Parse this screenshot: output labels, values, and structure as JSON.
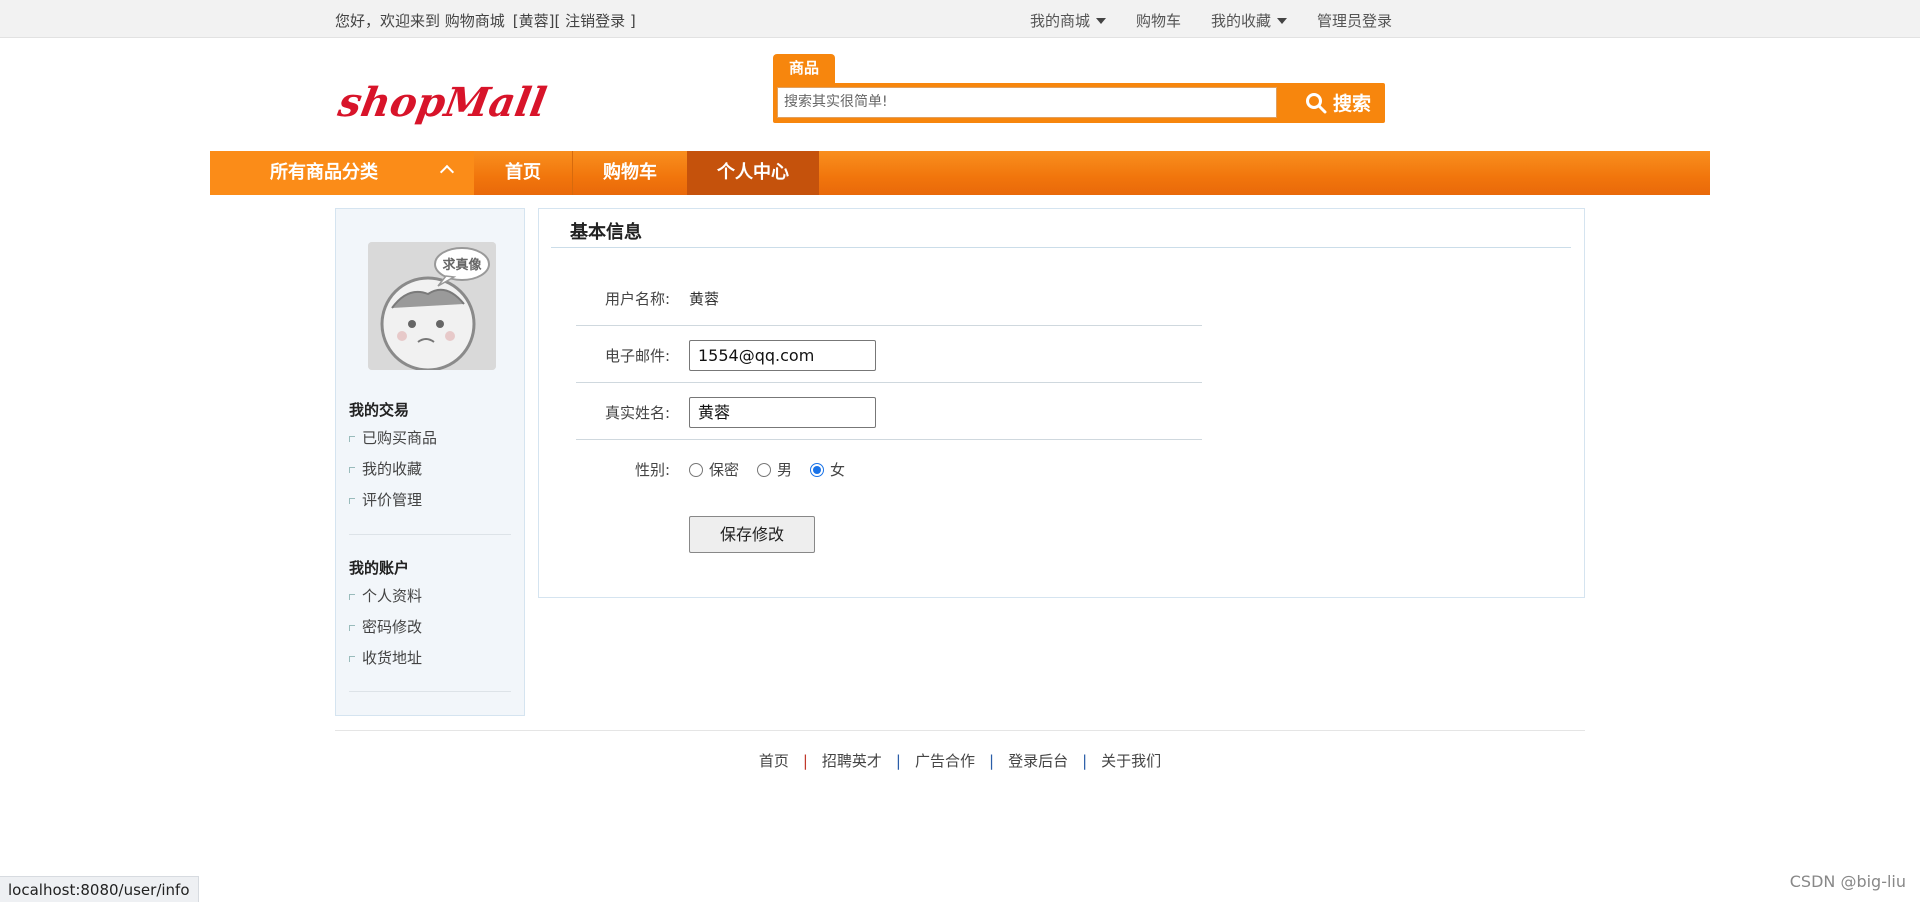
{
  "topbar": {
    "welcome": "您好，欢迎来到 购物商城",
    "user": "[黄蓉][",
    "logout": " 注销登录 ",
    "close_bracket": "]",
    "links": [
      "我的商城",
      "购物车",
      "我的收藏",
      "管理员登录"
    ]
  },
  "header": {
    "logo_text": "shopMall",
    "search_tab": "商品",
    "search_placeholder": "搜索其实很简单!",
    "search_button": "搜索"
  },
  "nav": {
    "category": "所有商品分类",
    "items": [
      "首页",
      "购物车",
      "个人中心"
    ],
    "active": "个人中心"
  },
  "sidebar": {
    "avatar_caption": "求真像",
    "trade_title": "我的交易",
    "trade_items": [
      "已购买商品",
      "我的收藏",
      "评价管理"
    ],
    "account_title": "我的账户",
    "account_items": [
      "个人资料",
      "密码修改",
      "收货地址"
    ]
  },
  "panel": {
    "title": "基本信息",
    "username_label": "用户名称:",
    "username": "黄蓉",
    "email_label": "电子邮件:",
    "email": "1554@qq.com",
    "realname_label": "真实姓名:",
    "realname": "黄蓉",
    "gender_label": "性别:",
    "gender_options": [
      "保密",
      "男",
      "女"
    ],
    "gender_selected": "女",
    "save_button": "保存修改"
  },
  "footer": {
    "links": [
      "首页",
      "招聘英才",
      "广告合作",
      "登录后台",
      "关于我们"
    ],
    "separator": "|"
  },
  "statusbar": {
    "url": "localhost:8080/user/info"
  },
  "watermark": "CSDN @big-liu",
  "colors": {
    "accent": "#f7860d",
    "nav_active": "#c5520c",
    "logo_red": "#d8142a",
    "panel_border": "#d5e4f0"
  }
}
